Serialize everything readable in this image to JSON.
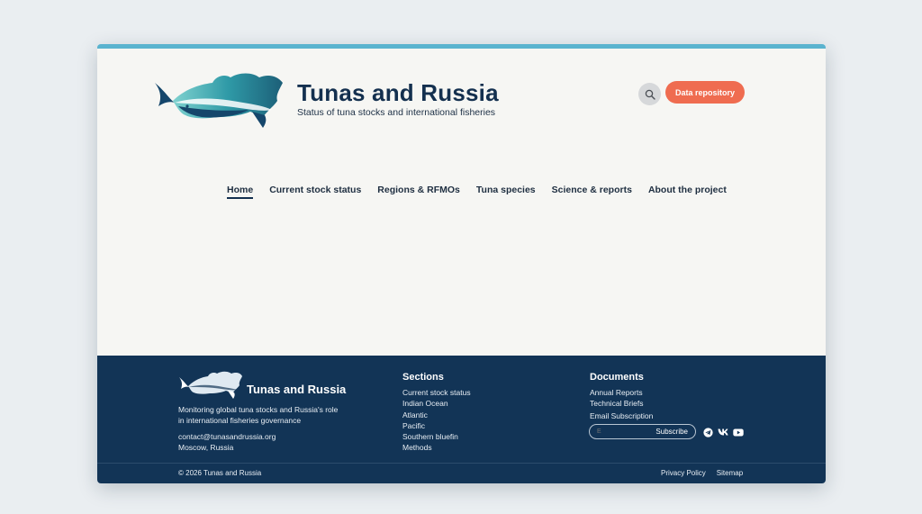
{
  "header": {
    "title": "Tunas and Russia",
    "tagline": "Status of tuna stocks and international fisheries",
    "repo_button": "Data repository"
  },
  "nav": {
    "items": [
      "Home",
      "Current stock status",
      "Regions & RFMOs",
      "Tuna species",
      "Science & reports",
      "About the project"
    ],
    "active": "Home"
  },
  "footer": {
    "brand": "Tunas and Russia",
    "description": "Monitoring global tuna stocks and Russia's role in international fisheries governance",
    "email": "contact@tunasandrussia.org",
    "location": "Moscow, Russia",
    "sections": {
      "title": "Sections",
      "links": [
        "Current stock status",
        "Indian Ocean",
        "Atlantic",
        "Pacific",
        "Southern bluefin",
        "Methods"
      ]
    },
    "documents": {
      "title": "Documents",
      "links": [
        "Annual Reports",
        "Technical Briefs"
      ]
    },
    "subscription": {
      "label": "Email Subscription",
      "placeholder": "E",
      "button": "Subscribe"
    },
    "copyright": "© 2026 Tunas and Russia",
    "legal": [
      "Privacy Policy",
      "Sitemap"
    ]
  },
  "colors": {
    "accent": "#ef6c50",
    "top_bar": "#5ab3cf",
    "footer_bg": "#123456",
    "title": "#14304f"
  },
  "icons": [
    "search-icon",
    "telegram-icon",
    "vk-icon",
    "youtube-icon"
  ]
}
